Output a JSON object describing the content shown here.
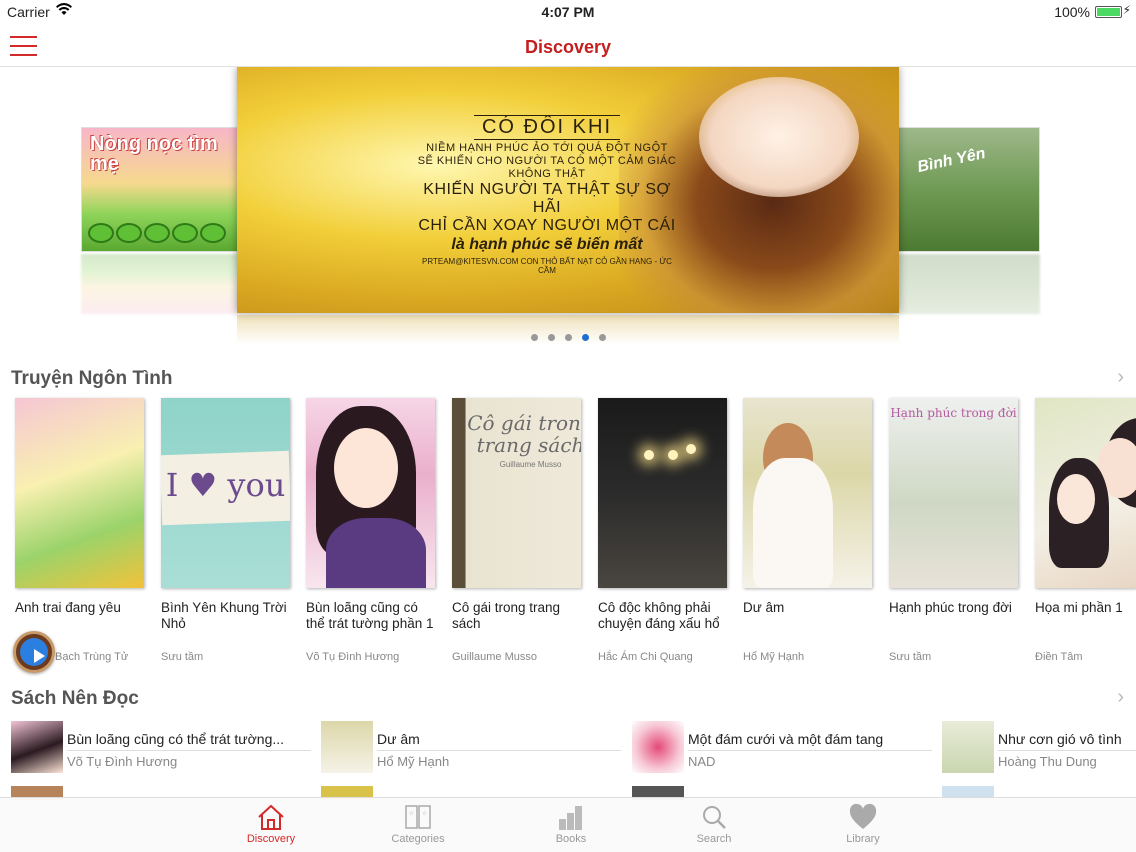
{
  "status": {
    "carrier": "Carrier",
    "time": "4:07 PM",
    "battery": "100%"
  },
  "nav": {
    "title": "Discovery"
  },
  "carousel": {
    "left_title": "Nòng nọc tìm mẹ",
    "right_title": "Bình Yên",
    "main": {
      "title": "CÓ ĐÔI KHI",
      "line1": "NIỀM HẠNH PHÚC ẢO TỚI QUÁ ĐỘT NGỘT",
      "line2": "SẼ KHIẾN CHO NGƯỜI TA CÓ MỘT CẢM GIÁC KHÔNG THẬT",
      "line3": "KHIẾN NGƯỜI TA THẬT SỰ SỢ HÃI",
      "line4": "CHỈ CẦN XOAY NGƯỜI MỘT CÁI",
      "line5": "là hạnh phúc sẽ biến mất",
      "credit": "PRTEAM@KITESVN.COM CON THỎ BẤT NẠT CỎ GẦN HANG - ỨC CẦM"
    },
    "page_count": 5,
    "active_index": 3
  },
  "section1": {
    "title": "Truyện Ngôn Tình",
    "books": [
      {
        "title": "Anh trai đang yêu",
        "author": "Bạch Trùng Tử"
      },
      {
        "title": "Bình Yên Khung Trời Nhỏ",
        "author": "Sưu tầm"
      },
      {
        "title": "Bùn loãng cũng có thể trát tường phần 1",
        "author": "Võ Tụ Đình Hương"
      },
      {
        "title": "Cô gái trong trang sách",
        "author": "Guillaume Musso"
      },
      {
        "title": "Cô độc không phải chuyện đáng xấu hổ",
        "author": "Hắc Ám Chi Quang"
      },
      {
        "title": "Dư âm",
        "author": "Hổ Mỹ Hạnh"
      },
      {
        "title": "Hạnh phúc trong đời",
        "author": "Sưu tầm"
      },
      {
        "title": "Họa mi phần 1",
        "author": "Điền Tâm"
      }
    ],
    "covers": {
      "cv2_text": "I ♥ you",
      "cv4_title": "Cô gái trong trang sách",
      "cv4_author": "Guillaume Musso",
      "cv7_title": "Hạnh phúc trong đời"
    }
  },
  "section2": {
    "title": "Sách Nên Đọc",
    "items": [
      {
        "title": "Bùn loãng cũng có thể trát tường...",
        "author": "Võ Tụ Đình Hương",
        "thumb_color": "#e9b9cf"
      },
      {
        "title": "Dư âm",
        "author": "Hổ Mỹ Hạnh",
        "thumb_color": "#dcd7a8"
      },
      {
        "title": "Một đám cưới và một đám tang",
        "author": "NAD",
        "thumb_color": "#f1c2d2"
      },
      {
        "title": "Như cơn gió vô tình",
        "author": "Hoàng Thu Dung",
        "thumb_color": "#d6e1c4"
      }
    ]
  },
  "tabs": [
    {
      "label": "Discovery",
      "icon": "home-icon",
      "active": true
    },
    {
      "label": "Categories",
      "icon": "categories-icon",
      "active": false
    },
    {
      "label": "Books",
      "icon": "books-icon",
      "active": false
    },
    {
      "label": "Search",
      "icon": "search-icon",
      "active": false
    },
    {
      "label": "Library",
      "icon": "heart-icon",
      "active": false
    }
  ],
  "colors": {
    "accent": "#d22a2a",
    "page_dot_active": "#1e6fd0"
  }
}
